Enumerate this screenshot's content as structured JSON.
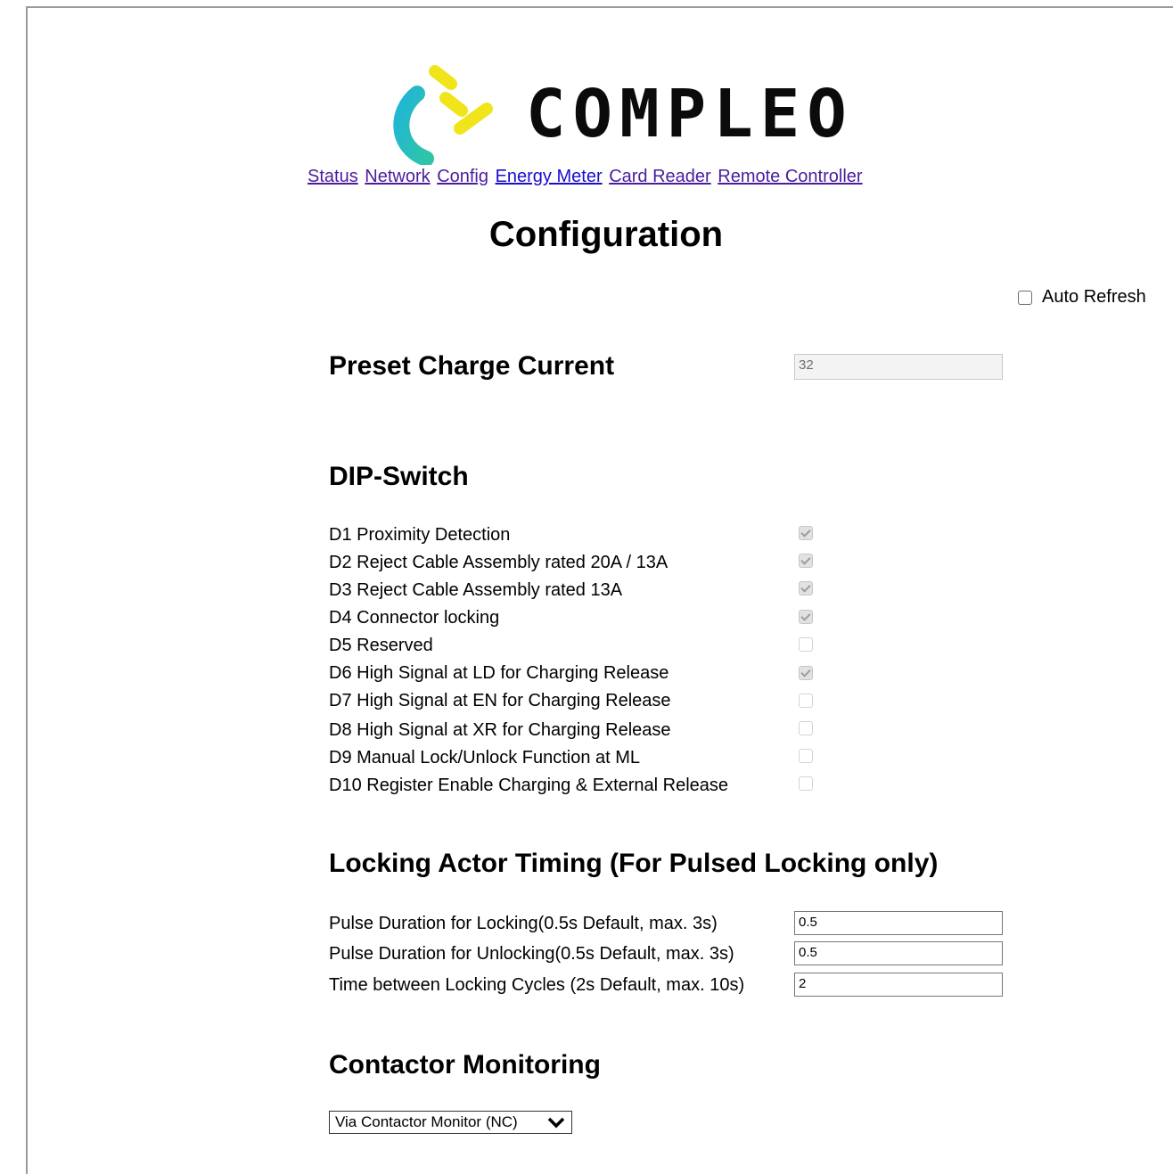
{
  "brand": {
    "name": "COMPLEO",
    "colors": {
      "yellow": "#f0e51a",
      "cyan": "#1fb6d6",
      "teal": "#2fc4a8"
    }
  },
  "nav": [
    {
      "label": "Status"
    },
    {
      "label": "Network"
    },
    {
      "label": "Config"
    },
    {
      "label": "Energy Meter"
    },
    {
      "label": "Card Reader"
    },
    {
      "label": "Remote Controller"
    }
  ],
  "page": {
    "title": "Configuration"
  },
  "auto_refresh": {
    "label": "Auto Refresh",
    "checked": false
  },
  "preset": {
    "heading": "Preset Charge Current",
    "value": "32",
    "disabled": true
  },
  "dip": {
    "heading": "DIP-Switch",
    "items": [
      {
        "label": "D1 Proximity Detection",
        "checked": true
      },
      {
        "label": "D2 Reject Cable Assembly rated 20A / 13A",
        "checked": true
      },
      {
        "label": "D3 Reject Cable Assembly rated 13A",
        "checked": true
      },
      {
        "label": "D4 Connector locking",
        "checked": true
      },
      {
        "label": "D5 Reserved",
        "checked": false
      },
      {
        "label": "D6 High Signal at LD for Charging Release",
        "checked": true
      },
      {
        "label": "D7 High Signal at EN for Charging Release",
        "checked": false
      },
      {
        "label": "D8 High Signal at XR for Charging Release",
        "checked": false
      },
      {
        "label": "D9 Manual Lock/Unlock Function at ML",
        "checked": false
      },
      {
        "label": "D10 Register Enable Charging & External Release",
        "checked": false
      }
    ]
  },
  "locking": {
    "heading": "Locking Actor Timing (For Pulsed Locking only)",
    "rows": [
      {
        "label": "Pulse Duration for Locking(0.5s Default, max. 3s)",
        "value": "0.5"
      },
      {
        "label": "Pulse Duration for Unlocking(0.5s Default, max. 3s)",
        "value": "0.5"
      },
      {
        "label": "Time between Locking Cycles (2s Default, max. 10s)",
        "value": "2"
      }
    ]
  },
  "contactor": {
    "heading": "Contactor Monitoring",
    "selected": "Via Contactor Monitor (NC)"
  }
}
